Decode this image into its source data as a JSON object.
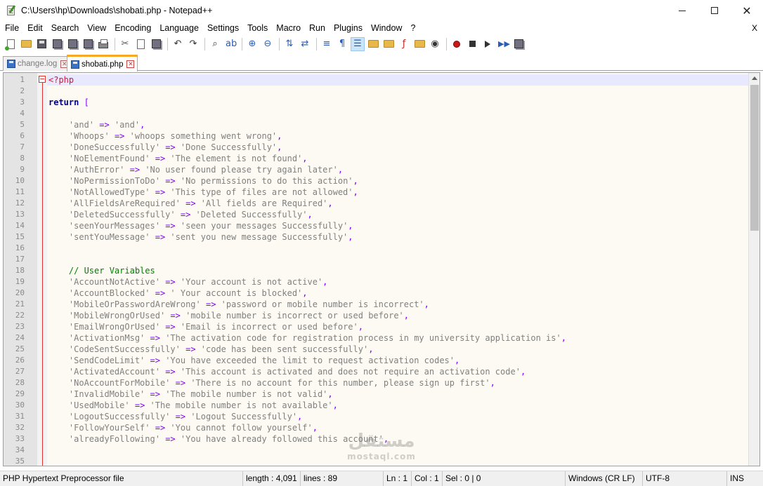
{
  "window": {
    "title": "C:\\Users\\hp\\Downloads\\shobati.php - Notepad++",
    "close_glyph": "✕"
  },
  "menu": {
    "items": [
      "File",
      "Edit",
      "Search",
      "View",
      "Encoding",
      "Language",
      "Settings",
      "Tools",
      "Macro",
      "Run",
      "Plugins",
      "Window",
      "?"
    ],
    "close_label": "X"
  },
  "toolbar": {
    "icons": [
      "new-file-icon",
      "open-file-icon",
      "save-icon",
      "save-all-icon",
      "close-icon",
      "close-all-icon",
      "print-icon",
      "cut-icon",
      "copy-icon",
      "paste-icon",
      "undo-icon",
      "redo-icon",
      "find-icon",
      "replace-icon",
      "zoom-in-icon",
      "zoom-out-icon",
      "sync-vertical-icon",
      "sync-horizontal-icon",
      "word-wrap-icon",
      "show-all-chars-icon",
      "indent-guide-icon",
      "udl-icon",
      "doc-map-icon",
      "function-list-icon",
      "folder-workspace-icon",
      "monitoring-icon",
      "record-macro-icon",
      "stop-macro-icon",
      "play-macro-icon",
      "run-macro-multiple-icon",
      "save-macro-icon"
    ]
  },
  "tabs": [
    {
      "label": "change.log",
      "active": false
    },
    {
      "label": "shobati.php",
      "active": true
    }
  ],
  "editor": {
    "current_line": 1,
    "lines": [
      {
        "n": "1",
        "parts": [
          [
            "tag",
            "<?php"
          ]
        ]
      },
      {
        "n": "2",
        "parts": []
      },
      {
        "n": "3",
        "parts": [
          [
            "kw",
            "return"
          ],
          [
            "",
            " "
          ],
          [
            "op",
            "["
          ]
        ]
      },
      {
        "n": "4",
        "parts": []
      },
      {
        "n": "5",
        "parts": [
          [
            "",
            "    "
          ],
          [
            "str",
            "'and'"
          ],
          [
            "",
            " "
          ],
          [
            "op",
            "=>"
          ],
          [
            "",
            " "
          ],
          [
            "str",
            "'and'"
          ],
          [
            "op",
            ","
          ]
        ]
      },
      {
        "n": "6",
        "parts": [
          [
            "",
            "    "
          ],
          [
            "str",
            "'Whoops'"
          ],
          [
            "",
            " "
          ],
          [
            "op",
            "=>"
          ],
          [
            "",
            " "
          ],
          [
            "str",
            "'whoops something went wrong'"
          ],
          [
            "op",
            ","
          ]
        ]
      },
      {
        "n": "7",
        "parts": [
          [
            "",
            "    "
          ],
          [
            "str",
            "'DoneSuccessfully'"
          ],
          [
            "",
            " "
          ],
          [
            "op",
            "=>"
          ],
          [
            "",
            " "
          ],
          [
            "str",
            "'Done Successfully'"
          ],
          [
            "op",
            ","
          ]
        ]
      },
      {
        "n": "8",
        "parts": [
          [
            "",
            "    "
          ],
          [
            "str",
            "'NoElementFound'"
          ],
          [
            "",
            " "
          ],
          [
            "op",
            "=>"
          ],
          [
            "",
            " "
          ],
          [
            "str",
            "'The element is not found'"
          ],
          [
            "op",
            ","
          ]
        ]
      },
      {
        "n": "9",
        "parts": [
          [
            "",
            "    "
          ],
          [
            "str",
            "'AuthError'"
          ],
          [
            "",
            " "
          ],
          [
            "op",
            "=>"
          ],
          [
            "",
            " "
          ],
          [
            "str",
            "'No user found please try again later'"
          ],
          [
            "op",
            ","
          ]
        ]
      },
      {
        "n": "10",
        "parts": [
          [
            "",
            "    "
          ],
          [
            "str",
            "'NoPermissionToDo'"
          ],
          [
            "",
            " "
          ],
          [
            "op",
            "=>"
          ],
          [
            "",
            " "
          ],
          [
            "str",
            "'No permissions to do this action'"
          ],
          [
            "op",
            ","
          ]
        ]
      },
      {
        "n": "11",
        "parts": [
          [
            "",
            "    "
          ],
          [
            "str",
            "'NotAllowedType'"
          ],
          [
            "",
            " "
          ],
          [
            "op",
            "=>"
          ],
          [
            "",
            " "
          ],
          [
            "str",
            "'This type of files are not allowed'"
          ],
          [
            "op",
            ","
          ]
        ]
      },
      {
        "n": "12",
        "parts": [
          [
            "",
            "    "
          ],
          [
            "str",
            "'AllFieldsAreRequired'"
          ],
          [
            "",
            " "
          ],
          [
            "op",
            "=>"
          ],
          [
            "",
            " "
          ],
          [
            "str",
            "'All fields are Required'"
          ],
          [
            "op",
            ","
          ]
        ]
      },
      {
        "n": "13",
        "parts": [
          [
            "",
            "    "
          ],
          [
            "str",
            "'DeletedSuccessfully'"
          ],
          [
            "",
            " "
          ],
          [
            "op",
            "=>"
          ],
          [
            "",
            " "
          ],
          [
            "str",
            "'Deleted Successfully'"
          ],
          [
            "op",
            ","
          ]
        ]
      },
      {
        "n": "14",
        "parts": [
          [
            "",
            "    "
          ],
          [
            "str",
            "'seenYourMessages'"
          ],
          [
            "",
            " "
          ],
          [
            "op",
            "=>"
          ],
          [
            "",
            " "
          ],
          [
            "str",
            "'seen your messages Successfully'"
          ],
          [
            "op",
            ","
          ]
        ]
      },
      {
        "n": "15",
        "parts": [
          [
            "",
            "    "
          ],
          [
            "str",
            "'sentYouMessage'"
          ],
          [
            "",
            " "
          ],
          [
            "op",
            "=>"
          ],
          [
            "",
            " "
          ],
          [
            "str",
            "'sent you new message Successfully'"
          ],
          [
            "op",
            ","
          ]
        ]
      },
      {
        "n": "16",
        "parts": []
      },
      {
        "n": "17",
        "parts": []
      },
      {
        "n": "18",
        "parts": [
          [
            "",
            "    "
          ],
          [
            "cm",
            "// User Variables"
          ]
        ]
      },
      {
        "n": "19",
        "parts": [
          [
            "",
            "    "
          ],
          [
            "str",
            "'AccountNotActive'"
          ],
          [
            "",
            " "
          ],
          [
            "op",
            "=>"
          ],
          [
            "",
            " "
          ],
          [
            "str",
            "'Your account is not active'"
          ],
          [
            "op",
            ","
          ]
        ]
      },
      {
        "n": "20",
        "parts": [
          [
            "",
            "    "
          ],
          [
            "str",
            "'AccountBlocked'"
          ],
          [
            "",
            " "
          ],
          [
            "op",
            "=>"
          ],
          [
            "",
            " "
          ],
          [
            "str",
            "' Your account is blocked'"
          ],
          [
            "op",
            ","
          ]
        ]
      },
      {
        "n": "21",
        "parts": [
          [
            "",
            "    "
          ],
          [
            "str",
            "'MobileOrPasswordAreWrong'"
          ],
          [
            "",
            " "
          ],
          [
            "op",
            "=>"
          ],
          [
            "",
            " "
          ],
          [
            "str",
            "'password or mobile number is incorrect'"
          ],
          [
            "op",
            ","
          ]
        ]
      },
      {
        "n": "22",
        "parts": [
          [
            "",
            "    "
          ],
          [
            "str",
            "'MobileWrongOrUsed'"
          ],
          [
            "",
            " "
          ],
          [
            "op",
            "=>"
          ],
          [
            "",
            " "
          ],
          [
            "str",
            "'mobile number is incorrect or used before'"
          ],
          [
            "op",
            ","
          ]
        ]
      },
      {
        "n": "23",
        "parts": [
          [
            "",
            "    "
          ],
          [
            "str",
            "'EmailWrongOrUsed'"
          ],
          [
            "",
            " "
          ],
          [
            "op",
            "=>"
          ],
          [
            "",
            " "
          ],
          [
            "str",
            "'Email is incorrect or used before'"
          ],
          [
            "op",
            ","
          ]
        ]
      },
      {
        "n": "24",
        "parts": [
          [
            "",
            "    "
          ],
          [
            "str",
            "'ActivationMsg'"
          ],
          [
            "",
            " "
          ],
          [
            "op",
            "=>"
          ],
          [
            "",
            " "
          ],
          [
            "str",
            "'The activation code for registration process in my university application is'"
          ],
          [
            "op",
            ","
          ]
        ]
      },
      {
        "n": "25",
        "parts": [
          [
            "",
            "    "
          ],
          [
            "str",
            "'CodeSentSuccessfully'"
          ],
          [
            "",
            " "
          ],
          [
            "op",
            "=>"
          ],
          [
            "",
            " "
          ],
          [
            "str",
            "'code has been sent successfully'"
          ],
          [
            "op",
            ","
          ]
        ]
      },
      {
        "n": "26",
        "parts": [
          [
            "",
            "    "
          ],
          [
            "str",
            "'SendCodeLimit'"
          ],
          [
            "",
            " "
          ],
          [
            "op",
            "=>"
          ],
          [
            "",
            " "
          ],
          [
            "str",
            "'You have exceeded the limit to request activation codes'"
          ],
          [
            "op",
            ","
          ]
        ]
      },
      {
        "n": "27",
        "parts": [
          [
            "",
            "    "
          ],
          [
            "str",
            "'ActivatedAccount'"
          ],
          [
            "",
            " "
          ],
          [
            "op",
            "=>"
          ],
          [
            "",
            " "
          ],
          [
            "str",
            "'This account is activated and does not require an activation code'"
          ],
          [
            "op",
            ","
          ]
        ]
      },
      {
        "n": "28",
        "parts": [
          [
            "",
            "    "
          ],
          [
            "str",
            "'NoAccountForMobile'"
          ],
          [
            "",
            " "
          ],
          [
            "op",
            "=>"
          ],
          [
            "",
            " "
          ],
          [
            "str",
            "'There is no account for this number, please sign up first'"
          ],
          [
            "op",
            ","
          ]
        ]
      },
      {
        "n": "29",
        "parts": [
          [
            "",
            "    "
          ],
          [
            "str",
            "'InvalidMobile'"
          ],
          [
            "",
            " "
          ],
          [
            "op",
            "=>"
          ],
          [
            "",
            " "
          ],
          [
            "str",
            "'The mobile number is not valid'"
          ],
          [
            "op",
            ","
          ]
        ]
      },
      {
        "n": "30",
        "parts": [
          [
            "",
            "    "
          ],
          [
            "str",
            "'UsedMobile'"
          ],
          [
            "",
            " "
          ],
          [
            "op",
            "=>"
          ],
          [
            "",
            " "
          ],
          [
            "str",
            "'The mobile number is not available'"
          ],
          [
            "op",
            ","
          ]
        ]
      },
      {
        "n": "31",
        "parts": [
          [
            "",
            "    "
          ],
          [
            "str",
            "'LogoutSuccessfully'"
          ],
          [
            "",
            " "
          ],
          [
            "op",
            "=>"
          ],
          [
            "",
            " "
          ],
          [
            "str",
            "'Logout Successfully'"
          ],
          [
            "op",
            ","
          ]
        ]
      },
      {
        "n": "32",
        "parts": [
          [
            "",
            "    "
          ],
          [
            "str",
            "'FollowYourSelf'"
          ],
          [
            "",
            " "
          ],
          [
            "op",
            "=>"
          ],
          [
            "",
            " "
          ],
          [
            "str",
            "'You cannot follow yourself'"
          ],
          [
            "op",
            ","
          ]
        ]
      },
      {
        "n": "33",
        "parts": [
          [
            "",
            "    "
          ],
          [
            "str",
            "'alreadyFollowing'"
          ],
          [
            "",
            " "
          ],
          [
            "op",
            "=>"
          ],
          [
            "",
            " "
          ],
          [
            "str",
            "'You have already followed this account'"
          ],
          [
            "op",
            ","
          ]
        ]
      },
      {
        "n": "34",
        "parts": []
      },
      {
        "n": "35",
        "parts": []
      }
    ]
  },
  "watermark": {
    "arabic": "مستقل",
    "latin": "mostaql.com"
  },
  "status": {
    "file_type": "PHP Hypertext Preprocessor file",
    "length": "length : 4,091",
    "lines": "lines : 89",
    "ln": "Ln : 1",
    "col": "Col : 1",
    "sel": "Sel : 0 | 0",
    "eol": "Windows (CR LF)",
    "encoding": "UTF-8",
    "mode": "INS"
  },
  "colors": {
    "editor_bg": "#fcfaf2",
    "current_line_bg": "#e8e8ff",
    "php_tag": "#e0103a",
    "keyword": "#00008b",
    "operator": "#8000ff",
    "string": "#808080",
    "comment": "#008000",
    "active_tab_accent": "#f9a825"
  }
}
